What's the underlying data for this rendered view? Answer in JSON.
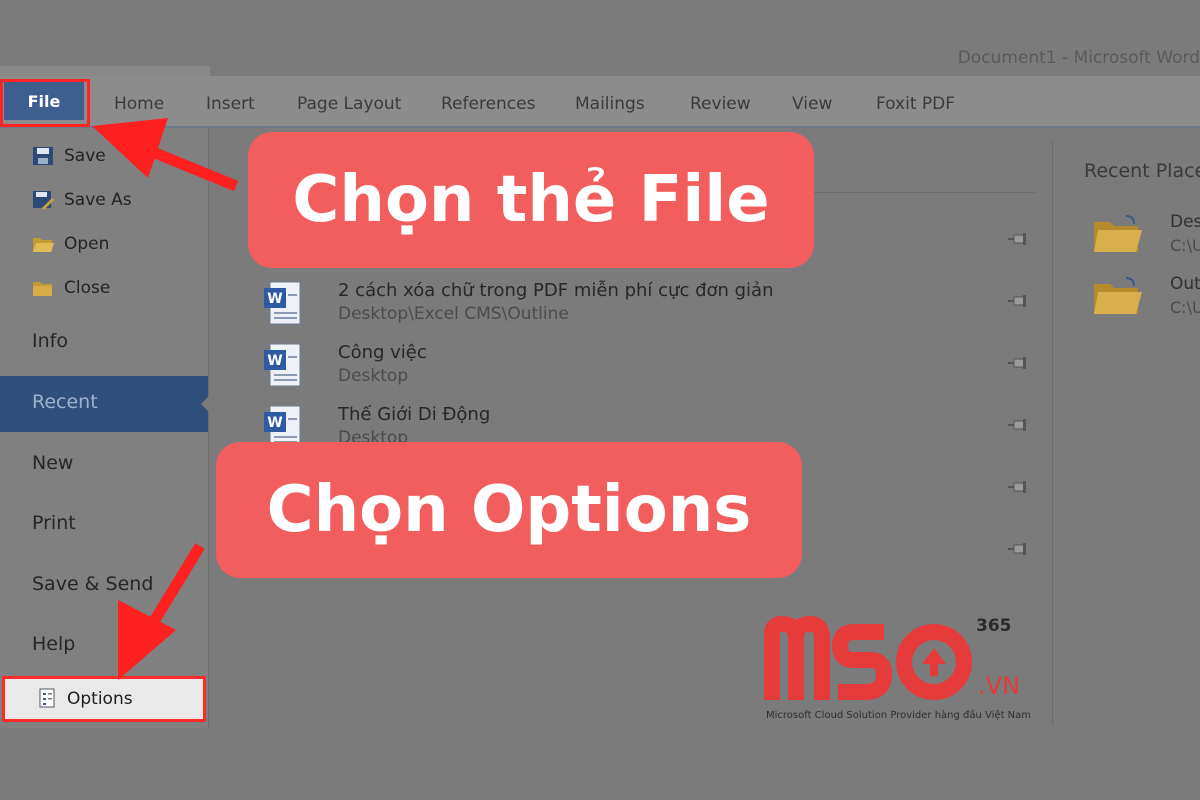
{
  "window": {
    "title": "Document1 - Microsoft Word"
  },
  "ribbon": {
    "file_tab": "File",
    "tabs": [
      "Home",
      "Insert",
      "Page Layout",
      "References",
      "Mailings",
      "Review",
      "View",
      "Foxit PDF"
    ]
  },
  "backstage_nav": {
    "commands": [
      {
        "label": "Save",
        "icon": "save-icon"
      },
      {
        "label": "Save As",
        "icon": "save-as-icon"
      },
      {
        "label": "Open",
        "icon": "open-folder-icon"
      },
      {
        "label": "Close",
        "icon": "close-folder-icon"
      }
    ],
    "info": "Info",
    "recent": "Recent",
    "new": "New",
    "print": "Print",
    "save_send": "Save & Send",
    "help": "Help",
    "options": "Options"
  },
  "recent_documents": [
    {
      "name": "2 cách xóa chữ trong PDF miễn phí cực đơn giản",
      "path": "Desktop\\Excel CMS\\Outline"
    },
    {
      "name": "Công việc",
      "path": "Desktop"
    },
    {
      "name": "Thế Giới Di Động",
      "path": "Desktop"
    }
  ],
  "recent_places": {
    "title": "Recent Places",
    "items": [
      {
        "name": "Desktop",
        "path": "C:\\Users"
      },
      {
        "name": "Outline",
        "path": "C:\\Users"
      }
    ]
  },
  "annotations": {
    "step_file": "Chọn thẻ File",
    "step_options": "Chọn Options",
    "highlight_color": "#ff2424",
    "callout_color": "#f25d5d"
  },
  "logo": {
    "text": "MSO",
    "superscript": "365",
    "domain": ".VN",
    "tagline": "Microsoft Cloud Solution Provider hàng đầu Việt Nam",
    "color": "#e53b3b"
  }
}
